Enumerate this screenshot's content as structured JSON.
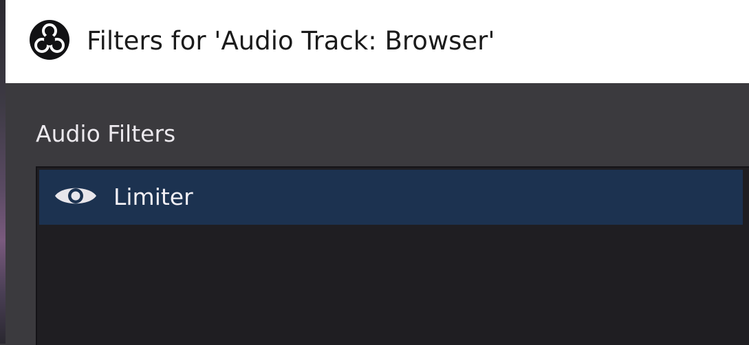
{
  "window": {
    "title": "Filters for 'Audio Track: Browser'",
    "icon": "obs-logo-icon"
  },
  "audio_filters": {
    "label": "Audio Filters",
    "items": [
      {
        "name": "Limiter",
        "visibility_icon": "eye-icon",
        "visible": true,
        "selected": true
      }
    ]
  },
  "colors": {
    "titlebar_bg": "#ffffff",
    "panel_bg": "#3b3a3e",
    "list_bg": "#1f1e22",
    "selected_row_bg": "#1c3250",
    "text_light": "#ece9ee"
  }
}
